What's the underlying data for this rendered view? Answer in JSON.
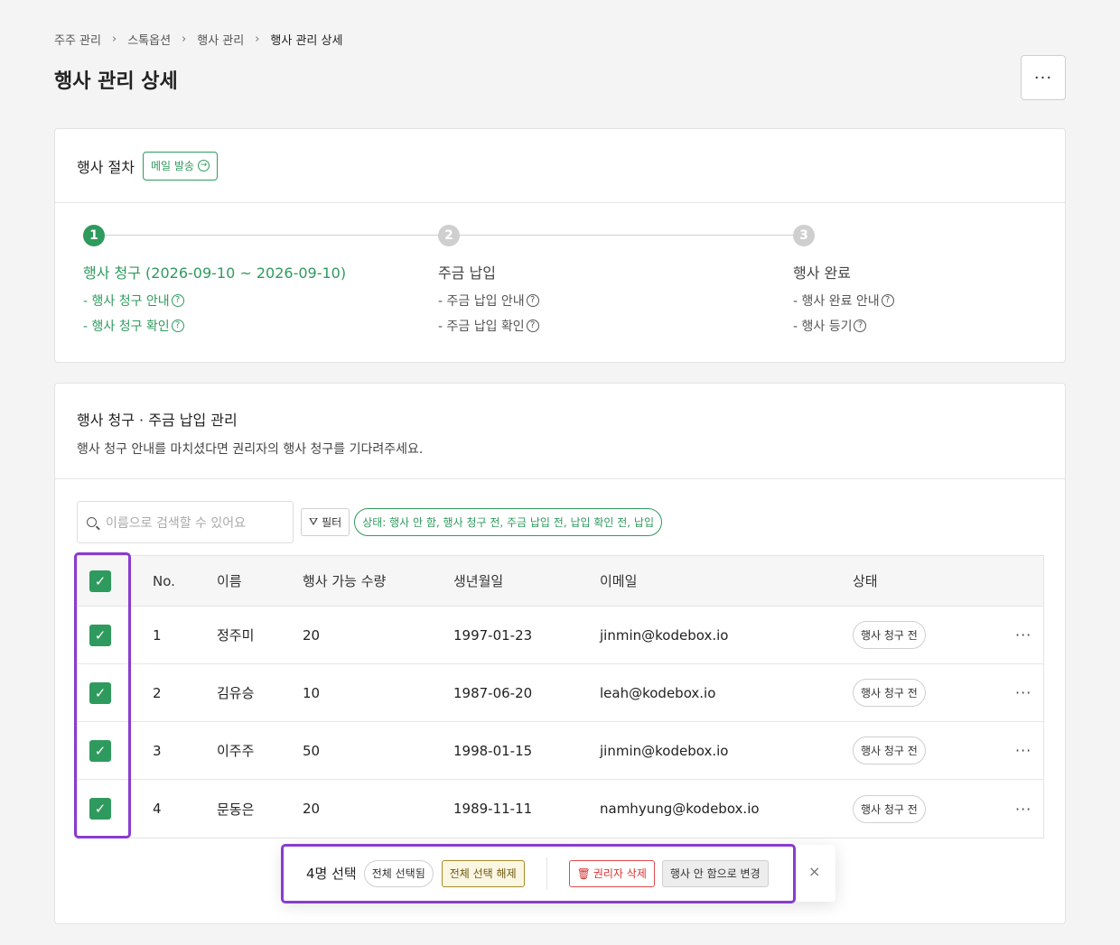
{
  "breadcrumb": [
    "주주 관리",
    "스톡옵션",
    "행사 관리",
    "행사 관리 상세"
  ],
  "page_title": "행사 관리 상세",
  "more_label": "···",
  "procedure": {
    "title": "행사 절차",
    "mail_button": "메일 발송",
    "steps": [
      {
        "number": "1",
        "name": "행사 청구 (2026-09-10 ~ 2026-09-10)",
        "items": [
          "- 행사 청구 안내",
          "- 행사 청구 확인"
        ],
        "active": true
      },
      {
        "number": "2",
        "name": "주금 납입",
        "items": [
          "- 주금 납입 안내",
          "- 주금 납입 확인"
        ],
        "active": false
      },
      {
        "number": "3",
        "name": "행사 완료",
        "items": [
          "- 행사 완료 안내",
          "- 행사 등기"
        ],
        "active": false
      }
    ]
  },
  "management": {
    "title": "행사 청구 · 주금 납입 관리",
    "description": "행사 청구 안내를 마치셨다면 권리자의 행사 청구를 기다려주세요.",
    "search_placeholder": "이름으로 검색할 수 있어요",
    "filter_label": "필터",
    "status_filter": "상태: 행사 안 함, 행사 청구 전, 주금 납입 전, 납입 확인 전, 납입",
    "columns": [
      "No.",
      "이름",
      "행사 가능 수량",
      "생년월일",
      "이메일",
      "상태"
    ],
    "rows": [
      {
        "no": "1",
        "name": "정주미",
        "qty": "20",
        "birth": "1997-01-23",
        "email": "jinmin@kodebox.io",
        "status": "행사 청구 전"
      },
      {
        "no": "2",
        "name": "김유승",
        "qty": "10",
        "birth": "1987-06-20",
        "email": "leah@kodebox.io",
        "status": "행사 청구 전"
      },
      {
        "no": "3",
        "name": "이주주",
        "qty": "50",
        "birth": "1998-01-15",
        "email": "jinmin@kodebox.io",
        "status": "행사 청구 전"
      },
      {
        "no": "4",
        "name": "문동은",
        "qty": "20",
        "birth": "1989-11-11",
        "email": "namhyung@kodebox.io",
        "status": "행사 청구 전"
      }
    ]
  },
  "selection_bar": {
    "count": "4명 선택",
    "all_selected": "전체 선택됨",
    "deselect_all": "전체 선택 해제",
    "delete_holder": "권리자 삭제",
    "change_status": "행사 안 함으로 변경",
    "close": "×"
  },
  "colors": {
    "accent": "#2f9a5e",
    "highlight": "#8a3bd0",
    "danger": "#d33333"
  },
  "icons": {
    "check": "✓",
    "question": "?",
    "arrow": "→",
    "filter": "⛛",
    "trash": "🗑"
  }
}
